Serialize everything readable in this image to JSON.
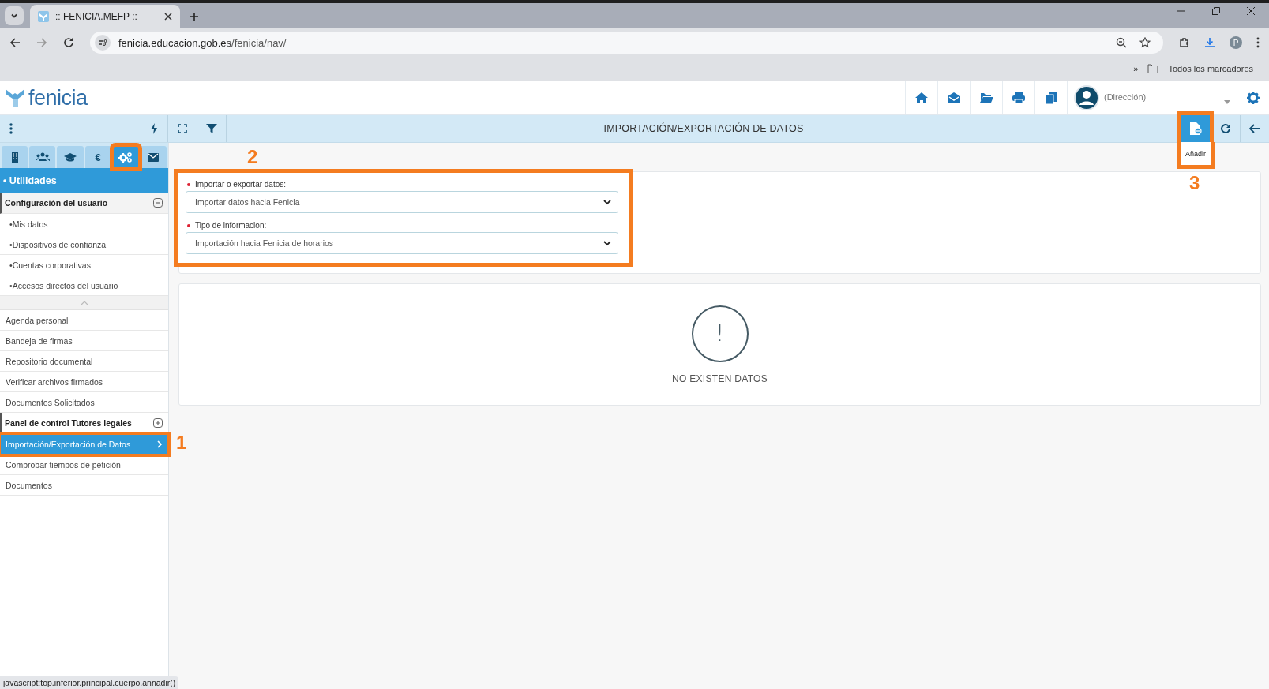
{
  "browser": {
    "tab_title": ":: FENICIA.MEFP ::",
    "url_host": "fenicia.educacion.gob.es",
    "url_path": "/fenicia/nav/",
    "bookmarks_overflow": "»",
    "bookmarks_label": "Todos los marcadores",
    "profile_initial": "P"
  },
  "header": {
    "logo_text": "fenicia",
    "user_role": "(Dirección)"
  },
  "toolbar": {
    "title": "IMPORTACIÓN/EXPORTACIÓN DE DATOS",
    "add_button": {
      "tooltip": "Añadir",
      "callout": "3"
    }
  },
  "sidebar": {
    "tabs": [
      {
        "kind": "icon",
        "selected": false,
        "highlighted": false
      },
      {
        "kind": "icon",
        "selected": false,
        "highlighted": false
      },
      {
        "kind": "icon",
        "selected": false,
        "highlighted": false
      },
      {
        "kind": "text",
        "label": "€",
        "selected": false,
        "highlighted": false
      },
      {
        "kind": "icon",
        "selected": true,
        "highlighted": true
      },
      {
        "kind": "icon",
        "selected": false,
        "highlighted": false
      }
    ],
    "section": "• Utilidades",
    "menu": [
      {
        "kind": "group",
        "label": "Configuración del usuario",
        "expanded": true,
        "children": [
          {
            "label": "•Mis datos",
            "selected": false
          },
          {
            "label": "•Dispositivos de confianza",
            "selected": false
          },
          {
            "label": "•Cuentas corporativas",
            "selected": false
          },
          {
            "label": "•Accesos directos del usuario",
            "selected": false
          }
        ]
      },
      {
        "kind": "item",
        "label": "Agenda personal",
        "selected": false
      },
      {
        "kind": "item",
        "label": "Bandeja de firmas",
        "selected": false
      },
      {
        "kind": "item",
        "label": "Repositorio documental",
        "selected": false
      },
      {
        "kind": "item",
        "label": "Verificar archivos firmados",
        "selected": false
      },
      {
        "kind": "item",
        "label": "Documentos Solicitados",
        "selected": false
      },
      {
        "kind": "group",
        "label": "Panel de control Tutores legales",
        "expanded": false
      },
      {
        "kind": "item",
        "label": "Importación/Exportación de Datos",
        "selected": true,
        "callout": "1"
      },
      {
        "kind": "item",
        "label": "Comprobar tiempos de petición",
        "selected": false
      },
      {
        "kind": "item",
        "label": "Documentos",
        "selected": false
      }
    ]
  },
  "form": {
    "callout": "2",
    "fields": [
      {
        "label": "Importar o exportar datos:",
        "required": true,
        "value": "Importar datos hacia Fenicia"
      },
      {
        "label": "Tipo de informacion:",
        "required": true,
        "value": "Importación hacia Fenicia de horarios"
      }
    ]
  },
  "empty_state": {
    "symbol": "!",
    "message": "NO EXISTEN DATOS"
  },
  "status_bar": "javascript:top.inferior.principal.cuerpo.annadir()"
}
